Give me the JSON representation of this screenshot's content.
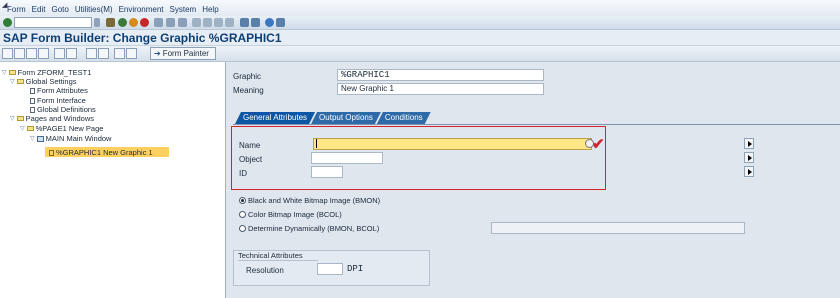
{
  "menu": {
    "items": [
      "Form",
      "Edit",
      "Goto",
      "Utilities(M)",
      "Environment",
      "System",
      "Help"
    ]
  },
  "title": "SAP Form Builder: Change Graphic %GRAPHIC1",
  "app_toolbar": {
    "form_painter_label": "Form Painter"
  },
  "tree": {
    "root": "Form ZFORM_TEST1",
    "global_settings": "Global Settings",
    "form_attributes": "Form Attributes",
    "form_interface": "Form Interface",
    "global_definitions": "Global Definitions",
    "pages_windows": "Pages and Windows",
    "page": "%PAGE1 New Page",
    "main_window": "MAIN Main Window",
    "graphic": "%GRAPHIC1 New Graphic 1"
  },
  "header_fields": {
    "graphic_label": "Graphic",
    "graphic_value": "%GRAPHIC1",
    "meaning_label": "Meaning",
    "meaning_value": "New Graphic 1"
  },
  "tabs": [
    "General Attributes",
    "Output Options",
    "Conditions"
  ],
  "general": {
    "name_label": "Name",
    "name_value": "",
    "object_label": "Object",
    "object_value": "",
    "id_label": "ID",
    "id_value": ""
  },
  "radios": {
    "bmon": "Black and White Bitmap Image (BMON)",
    "bcol": "Color Bitmap Image (BCOL)",
    "dyn": "Determine Dynamically (BMON, BCOL)",
    "selected": "bmon"
  },
  "technical": {
    "title": "Technical Attributes",
    "resolution_label": "Resolution",
    "resolution_value": "",
    "unit": "DPI"
  },
  "colors": {
    "highlight": "#d6202a",
    "selection": "#ffd05e",
    "title": "#0e3f73"
  }
}
